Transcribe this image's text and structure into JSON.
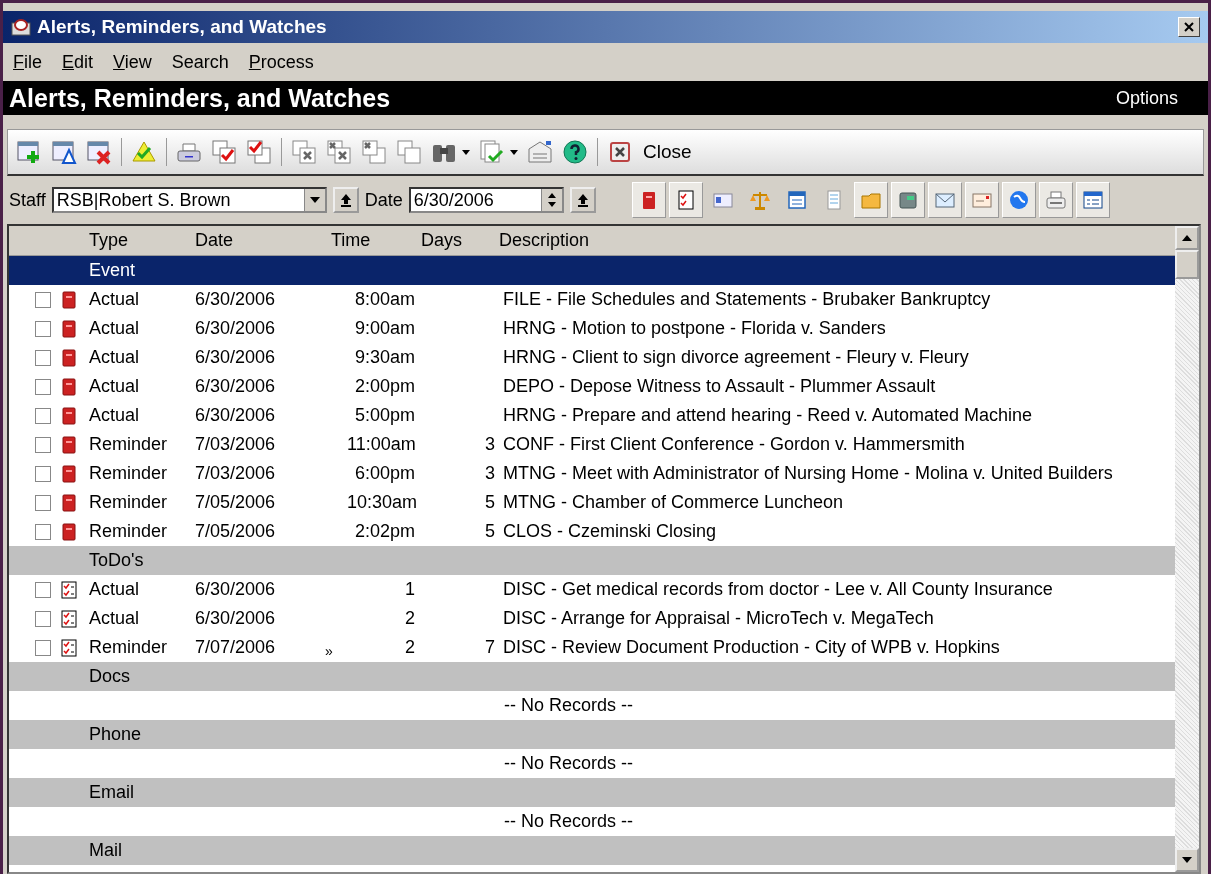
{
  "window": {
    "title": "Alerts, Reminders, and Watches"
  },
  "menu": [
    {
      "label": "File",
      "mnemonic": true
    },
    {
      "label": "Edit",
      "mnemonic": true
    },
    {
      "label": "View",
      "mnemonic": true
    },
    {
      "label": "Search",
      "mnemonic": false
    },
    {
      "label": "Process",
      "mnemonic": true
    }
  ],
  "header": {
    "title": "Alerts, Reminders, and Watches",
    "options": "Options"
  },
  "toolbar": {
    "close_label": "Close"
  },
  "filter_bar": {
    "staff_label": "Staff",
    "staff_value": "RSB|Robert S. Brown",
    "date_label": "Date",
    "date_value": "6/30/2006"
  },
  "view_filters": [
    {
      "kind": "event",
      "selected": true
    },
    {
      "kind": "todo",
      "selected": true
    },
    {
      "kind": "contact",
      "selected": false
    },
    {
      "kind": "scales",
      "selected": false
    },
    {
      "kind": "form",
      "selected": false
    },
    {
      "kind": "notes",
      "selected": false
    },
    {
      "kind": "folder",
      "selected": true
    },
    {
      "kind": "phone",
      "selected": true
    },
    {
      "kind": "envelope",
      "selected": true
    },
    {
      "kind": "mail",
      "selected": true
    },
    {
      "kind": "globe",
      "selected": true
    },
    {
      "kind": "printer",
      "selected": true
    },
    {
      "kind": "calendar",
      "selected": true
    }
  ],
  "table": {
    "columns": [
      "Type",
      "Date",
      "Time",
      "Days",
      "Description"
    ],
    "groups": [
      {
        "label": "Event",
        "selected": true,
        "rows": [
          {
            "kind": "event",
            "checked": false,
            "type": "Actual",
            "date": "6/30/2006",
            "time": "8:00am",
            "description": "FILE - File Schedules and Statements - Brubaker Bankruptcy"
          },
          {
            "kind": "event",
            "checked": false,
            "type": "Actual",
            "date": "6/30/2006",
            "time": "9:00am",
            "description": "HRNG - Motion to postpone - Florida v. Sanders"
          },
          {
            "kind": "event",
            "checked": false,
            "type": "Actual",
            "date": "6/30/2006",
            "time": "9:30am",
            "description": "HRNG - Client to sign divorce agreement - Fleury v. Fleury"
          },
          {
            "kind": "event",
            "checked": false,
            "type": "Actual",
            "date": "6/30/2006",
            "time": "2:00pm",
            "description": "DEPO - Depose Witness to Assault - Plummer Assault"
          },
          {
            "kind": "event",
            "checked": false,
            "type": "Actual",
            "date": "6/30/2006",
            "time": "5:00pm",
            "description": "HRNG - Prepare and attend hearing - Reed v. Automated Machine"
          },
          {
            "kind": "event",
            "checked": false,
            "type": "Reminder",
            "date": "7/03/2006",
            "time": "11:00am",
            "days": "3",
            "description": "CONF - First Client Conference - Gordon v. Hammersmith"
          },
          {
            "kind": "event",
            "checked": false,
            "type": "Reminder",
            "date": "7/03/2006",
            "time": "6:00pm",
            "days": "3",
            "description": "MTNG - Meet with Administrator of Nursing Home - Molina v. United Builders"
          },
          {
            "kind": "event",
            "checked": false,
            "type": "Reminder",
            "date": "7/05/2006",
            "time": "10:30am",
            "days": "5",
            "description": "MTNG - Chamber of Commerce Luncheon"
          },
          {
            "kind": "event",
            "checked": false,
            "type": "Reminder",
            "date": "7/05/2006",
            "time": "2:02pm",
            "days": "5",
            "description": "CLOS - Czeminski Closing"
          }
        ]
      },
      {
        "label": "ToDo's",
        "selected": false,
        "rows": [
          {
            "kind": "todo",
            "checked": false,
            "type": "Actual",
            "date": "6/30/2006",
            "time": "1",
            "description": "DISC - Get medical records from doctor - Lee v. All County Insurance"
          },
          {
            "kind": "todo",
            "checked": false,
            "type": "Actual",
            "date": "6/30/2006",
            "time": "2",
            "description": "DISC - Arrange for Appraisal - MicroTech v. MegaTech"
          },
          {
            "kind": "todo",
            "checked": false,
            "type": "Reminder",
            "date": "7/07/2006",
            "marker": "»",
            "time": "2",
            "days": "7",
            "description": "DISC - Review Document Production - City of WPB v. Hopkins"
          }
        ]
      },
      {
        "label": "Docs",
        "selected": false,
        "empty_text": "-- No Records --"
      },
      {
        "label": "Phone",
        "selected": false,
        "empty_text": "-- No Records --"
      },
      {
        "label": "Email",
        "selected": false,
        "empty_text": "-- No Records --"
      },
      {
        "label": "Mail",
        "selected": false
      }
    ]
  }
}
